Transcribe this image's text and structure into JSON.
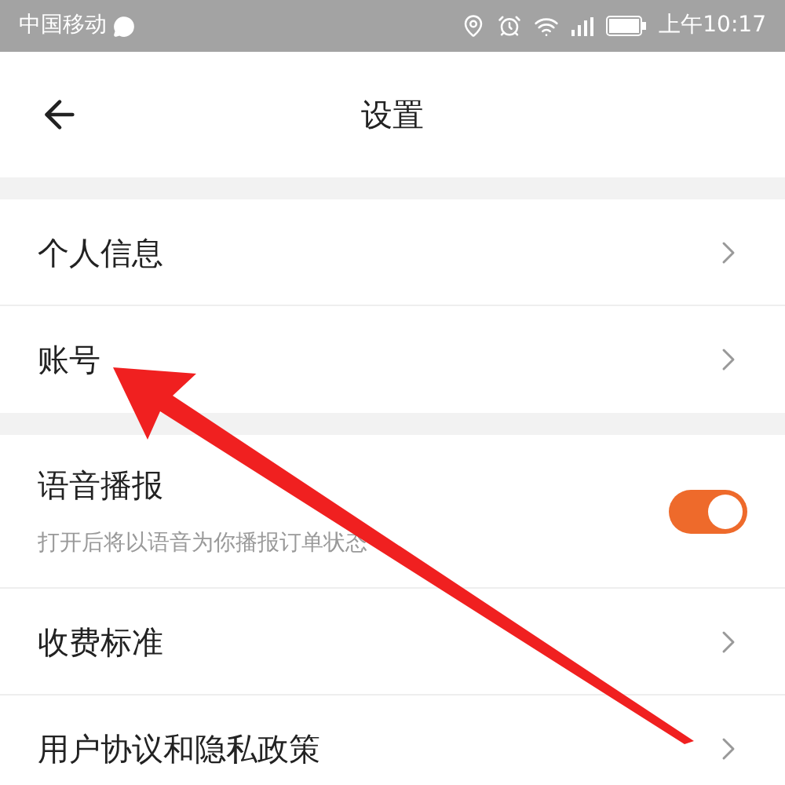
{
  "status_bar": {
    "carrier": "中国移动",
    "time": "上午10:17"
  },
  "header": {
    "title": "设置"
  },
  "sections": [
    {
      "items": [
        {
          "kind": "link",
          "label": "个人信息"
        },
        {
          "kind": "link",
          "label": "账号"
        }
      ]
    },
    {
      "items": [
        {
          "kind": "toggle",
          "label": "语音播报",
          "description": "打开后将以语音为你播报订单状态",
          "on": true
        },
        {
          "kind": "link",
          "label": "收费标准"
        },
        {
          "kind": "link",
          "label": "用户协议和隐私政策"
        }
      ]
    }
  ]
}
